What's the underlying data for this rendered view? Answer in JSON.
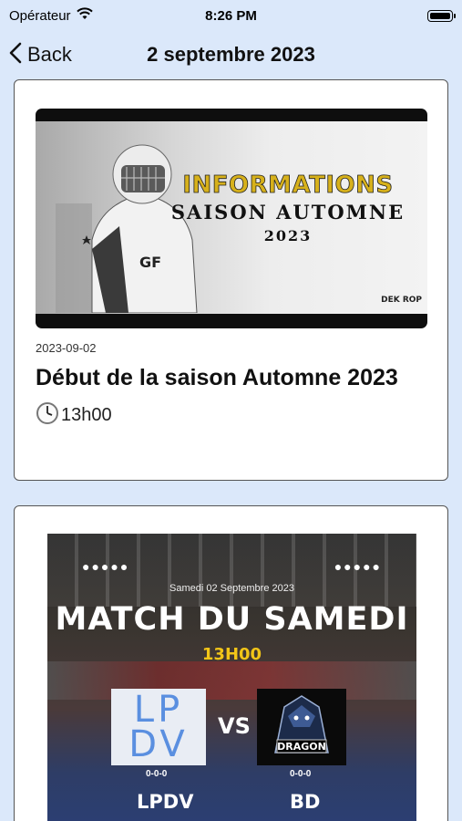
{
  "status": {
    "carrier": "Opérateur",
    "time": "8:26 PM"
  },
  "nav": {
    "back_label": "Back",
    "title": "2 septembre 2023"
  },
  "events": [
    {
      "poster": {
        "headline": "INFORMATIONS",
        "subline": "SAISON AUTOMNE",
        "year": "2023",
        "logo_text": "DEK ROP"
      },
      "date": "2023-09-02",
      "title": "Début de la saison Automne 2023",
      "time": "13h00",
      "time_icon": "clock-icon"
    },
    {
      "poster": {
        "date_line": "Samedi 02 Septembre 2023",
        "headline": "MATCH DU SAMEDI",
        "time": "13H00",
        "vs": "VS",
        "home_team": {
          "logo_text": "LPDV",
          "record": "0-0-0",
          "name": "LPDV"
        },
        "away_team": {
          "logo_text": "DRAGON",
          "record": "0-0-0",
          "name": "BD"
        }
      }
    }
  ]
}
